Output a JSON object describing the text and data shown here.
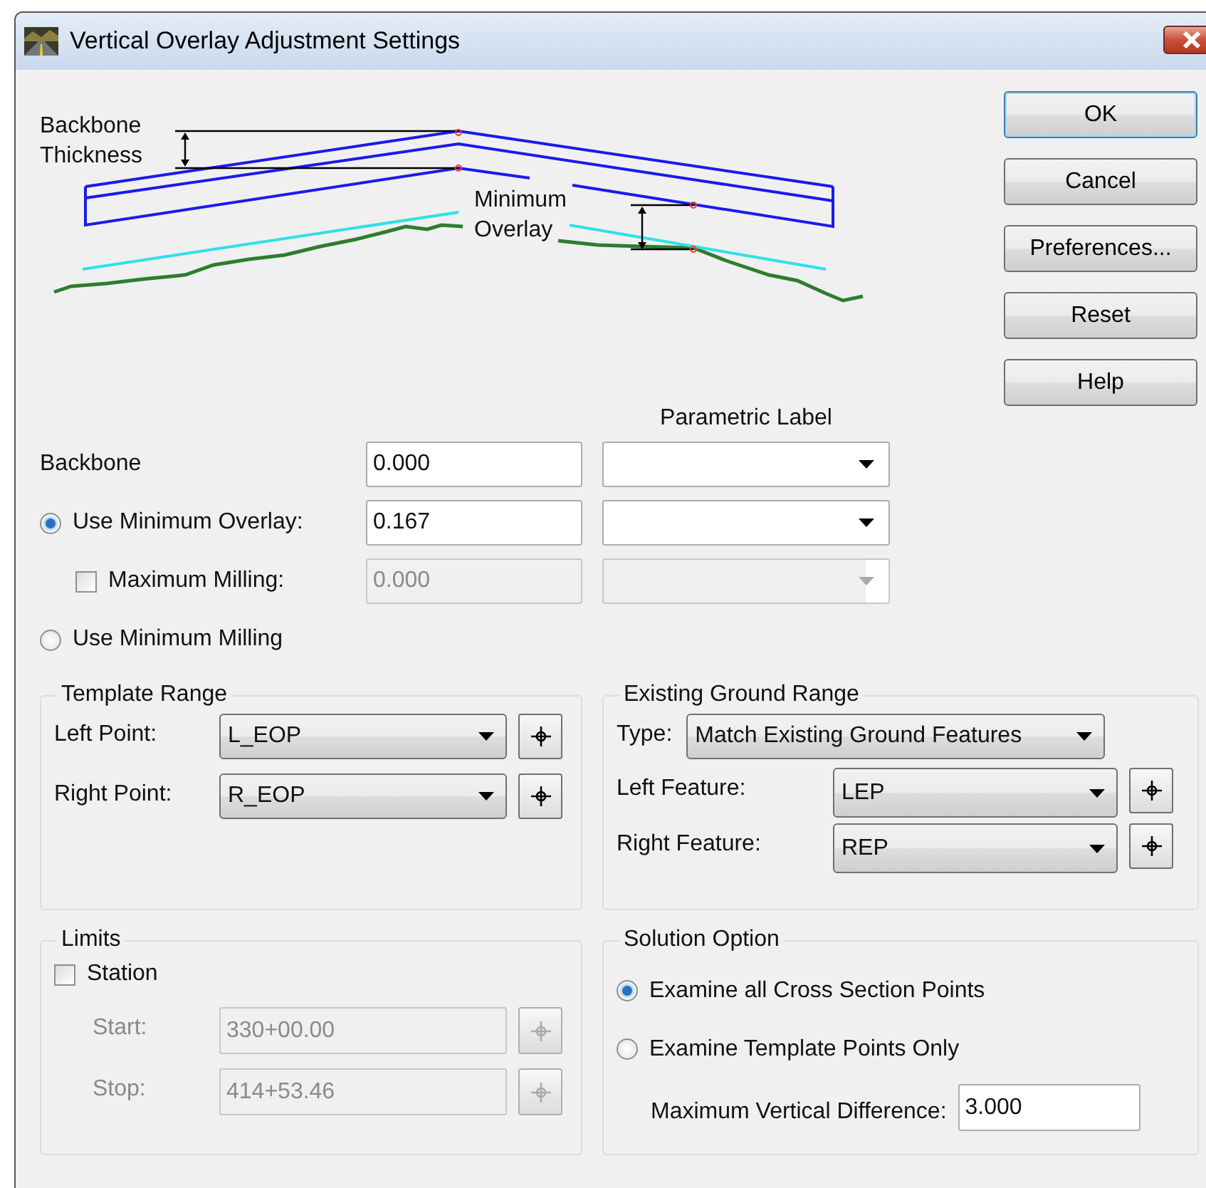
{
  "window": {
    "title": "Vertical Overlay Adjustment Settings"
  },
  "diagram": {
    "labels": [
      {
        "lines": [
          "Backbone",
          "Thickness"
        ]
      },
      {
        "lines": [
          "Minimum",
          "Overlay"
        ]
      }
    ]
  },
  "buttons": [
    {
      "label": "OK",
      "default": true
    },
    {
      "label": "Cancel",
      "default": false
    },
    {
      "label": "Preferences...",
      "default": false
    },
    {
      "label": "Reset",
      "default": false
    },
    {
      "label": "Help",
      "default": false
    }
  ],
  "parametric_label_heading": "Parametric Label",
  "rows": [
    {
      "kind": "label",
      "label": "Backbone",
      "value": "0.000",
      "disabled": false
    },
    {
      "kind": "radio",
      "label": "Use Minimum Overlay:",
      "selected": true,
      "value": "0.167",
      "disabled": false
    },
    {
      "kind": "checkbox",
      "label": "Maximum Milling:",
      "checked": false,
      "value": "0.000",
      "disabled": true
    },
    {
      "kind": "radio",
      "label": "Use Minimum Milling",
      "selected": false
    }
  ],
  "template_range": {
    "title": "Template Range",
    "points": [
      {
        "label": "Left Point:",
        "value": "L_EOP"
      },
      {
        "label": "Right Point:",
        "value": "R_EOP"
      }
    ]
  },
  "existing_ground_range": {
    "title": "Existing Ground Range",
    "type_label": "Type:",
    "type_value": "Match Existing Ground Features",
    "features": [
      {
        "label": "Left Feature:",
        "value": "LEP"
      },
      {
        "label": "Right Feature:",
        "value": "REP"
      }
    ]
  },
  "limits": {
    "title": "Limits",
    "station": {
      "label": "Station",
      "checked": false
    },
    "fields": [
      {
        "label": "Start:",
        "value": "330+00.00"
      },
      {
        "label": "Stop:",
        "value": "414+53.46"
      }
    ]
  },
  "solution_option": {
    "title": "Solution Option",
    "options": [
      {
        "label": "Examine all Cross Section Points",
        "selected": true
      },
      {
        "label": "Examine Template Points Only",
        "selected": false
      }
    ],
    "max_diff_label": "Maximum Vertical Difference:",
    "max_diff_value": "3.000"
  }
}
